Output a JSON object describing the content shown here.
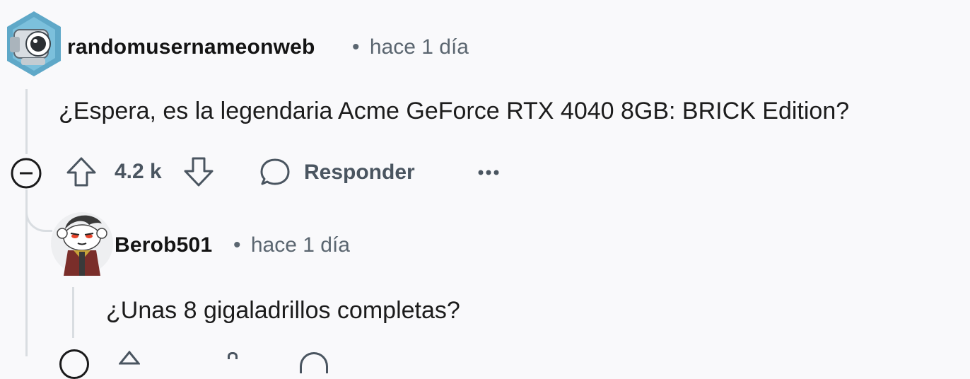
{
  "comment": {
    "username": "randomusernameonweb",
    "separator": "•",
    "time": "hace 1 día",
    "body": "¿Espera, es la legendaria Acme GeForce RTX 4040 8GB: BRICK Edition?",
    "score": "4.2 k",
    "reply_label": "Responder",
    "more_label": "•••",
    "avatar_icon": "robot-camera-avatar-icon"
  },
  "reply": {
    "username": "Berob501",
    "separator": "•",
    "time": "hace 1 día",
    "body": "¿Unas 8 gigaladrillos completas?",
    "avatar_icon": "snoo-avatar-icon"
  },
  "colors": {
    "background": "#f9f9fb",
    "thread_line": "#d9dde1",
    "muted_text": "#5b6670",
    "avatar_hex": "#5fa8c8"
  }
}
